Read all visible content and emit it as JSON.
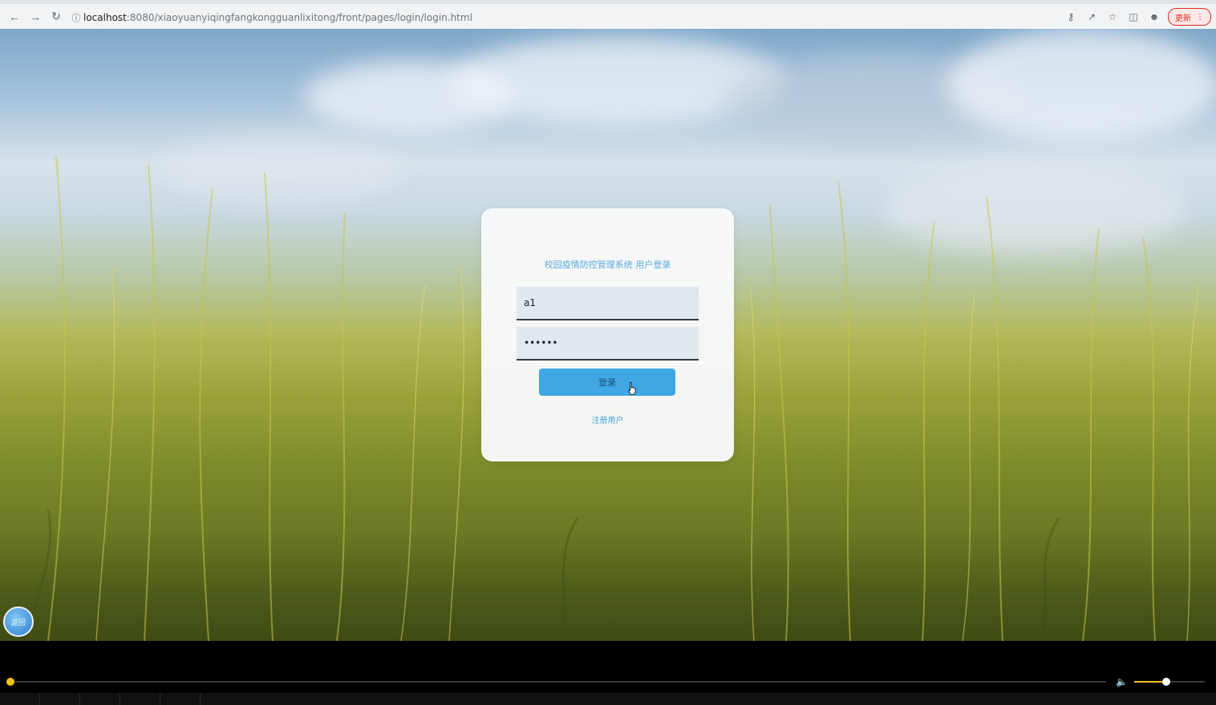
{
  "browser": {
    "url_host": "localhost",
    "url_path": ":8080/xiaoyuanyiqingfangkongguanlixitong/front/pages/login/login.html",
    "update_label": "更新",
    "icons": [
      "back-icon",
      "forward-icon",
      "reload-icon",
      "info-icon",
      "key-icon",
      "share-icon",
      "star-icon",
      "sidepanel-icon",
      "profile-icon",
      "menu-icon"
    ]
  },
  "login": {
    "title": "校园疫情防控管理系统 用户登录",
    "username_value": "a1",
    "password_value": "••••••",
    "login_label": "登录",
    "register_label": "注册用户"
  },
  "float_button": {
    "label": "返回"
  },
  "player": {
    "progress": 0.0,
    "volume": 0.45,
    "accent": "#f2c21a"
  },
  "colors": {
    "button": "#3fa7e3",
    "title": "#5aa8d8"
  }
}
